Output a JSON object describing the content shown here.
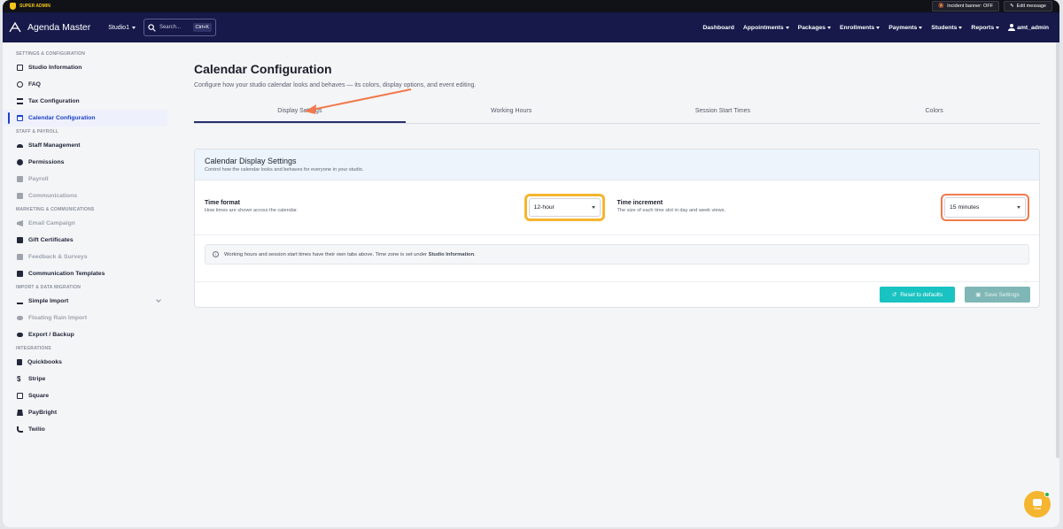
{
  "superbar": {
    "label": "SUPER ADMIN",
    "incident_label": "Incident banner: OFF",
    "edit_label": "Edit message"
  },
  "navbar": {
    "app_name": "Agenda Master",
    "studio": "Studio1",
    "search_placeholder": "Search...",
    "search_shortcut": "Ctrl+K",
    "links": {
      "dashboard": "Dashboard",
      "appointments": "Appointments",
      "packages": "Packages",
      "enrollments": "Enrollments",
      "payments": "Payments",
      "students": "Students",
      "reports": "Reports"
    },
    "user": "amt_admin"
  },
  "sidebar": {
    "sections": {
      "settings": "SETTINGS & CONFIGURATION",
      "staff": "STAFF & PAYROLL",
      "marketing": "MARKETING & COMMUNICATIONS",
      "import": "IMPORT & DATA MIGRATION",
      "integrations": "INTEGRATIONS"
    },
    "items": {
      "studio_information": "Studio Information",
      "faq": "FAQ",
      "tax_configuration": "Tax Configuration",
      "calendar_configuration": "Calendar Configuration",
      "staff_management": "Staff Management",
      "permissions": "Permissions",
      "payroll": "Payroll",
      "communications": "Communications",
      "email_campaign": "Email Campaign",
      "gift_certificates": "Gift Certificates",
      "feedback_surveys": "Feedback & Surveys",
      "communication_templates": "Communication Templates",
      "simple_import": "Simple Import",
      "floating_rain_import": "Floating Rain Import",
      "export_backup": "Export / Backup",
      "quickbooks": "Quickbooks",
      "stripe": "Stripe",
      "square": "Square",
      "paybright": "PayBright",
      "twilio": "Twilio"
    }
  },
  "main": {
    "title": "Calendar Configuration",
    "subtitle": "Configure how your studio calendar looks and behaves — its colors, display options, and event editing.",
    "tabs": {
      "display": "Display Settings",
      "hours": "Working Hours",
      "session": "Session Start Times",
      "colors": "Colors"
    },
    "card": {
      "title": "Calendar Display Settings",
      "subtitle": "Control how the calendar looks and behaves for everyone in your studio.",
      "time_format_label": "Time format",
      "time_format_help": "How times are shown across the calendar.",
      "time_format_value": "12-hour",
      "time_increment_label": "Time increment",
      "time_increment_help": "The size of each time slot in day and week views.",
      "time_increment_value": "15 minutes",
      "notice_prefix": "Working hours and session start times have their own tabs above. Time zone is set under ",
      "notice_link": "Studio Information",
      "notice_suffix": ".",
      "reset_label": "Reset to defaults",
      "save_label": "Save Settings"
    }
  },
  "chat": {
    "label": "Chat"
  },
  "colors": {
    "navbar": "#16194a",
    "accent": "#1d3fc4",
    "teal": "#19c3c1",
    "highlight_yellow": "#f5b52e",
    "highlight_orange": "#f07a4c"
  }
}
